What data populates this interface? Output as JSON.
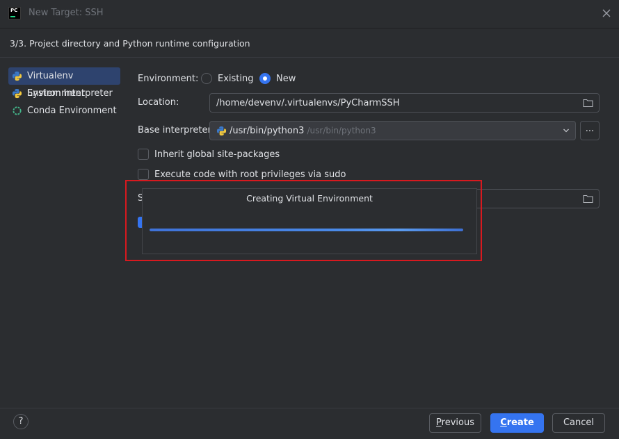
{
  "window": {
    "title": "New Target: SSH",
    "app_icon_text": "PC",
    "close_icon": "close-icon"
  },
  "step": {
    "label": "3/3. Project directory and Python runtime configuration"
  },
  "sidebar": {
    "items": [
      {
        "label": "Virtualenv Environment",
        "icon": "python-icon",
        "selected": true
      },
      {
        "label": "System Interpreter",
        "icon": "python-icon",
        "selected": false
      },
      {
        "label": "Conda Environment",
        "icon": "conda-icon",
        "selected": false
      }
    ]
  },
  "form": {
    "environment_label": "Environment:",
    "env_options": [
      {
        "label": "Existing",
        "selected": false
      },
      {
        "label": "New",
        "selected": true
      }
    ],
    "location_label": "Location:",
    "location_value": "/home/devenv/.virtualenvs/PyCharmSSH",
    "base_interpreter_label": "Base interpreter:",
    "base_interpreter_value": "/usr/bin/python3",
    "base_interpreter_hint": "/usr/bin/python3",
    "browse_label": "...",
    "inherit_label": "Inherit global site-packages",
    "inherit_checked": false,
    "sudo_label": "Execute code with root privileges via sudo",
    "sudo_checked": false,
    "obscured_label_fragment": "S",
    "obscured_checkbox_checked": true
  },
  "progress_dialog": {
    "title": "Creating Virtual Environment",
    "progress": 1.0
  },
  "footer": {
    "help_label": "?",
    "previous_label_mnemonic": "P",
    "previous_label_rest": "revious",
    "create_label_mnemonic": "C",
    "create_label_rest": "reate",
    "cancel_label": "Cancel"
  },
  "colors": {
    "accent": "#3574f0",
    "background": "#2b2d30",
    "highlight_box": "#d8191f"
  }
}
